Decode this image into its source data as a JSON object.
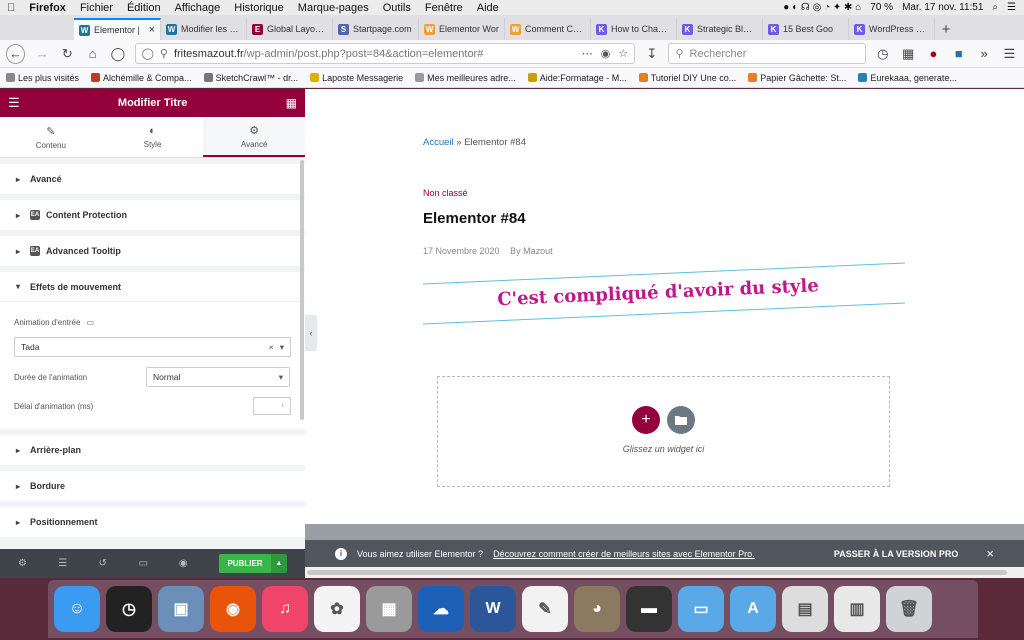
{
  "menubar": {
    "app": "Firefox",
    "items": [
      "Fichier",
      "Édition",
      "Affichage",
      "Historique",
      "Marque-pages",
      "Outils",
      "Fenêtre",
      "Aide"
    ],
    "battery": "70 %",
    "datetime": "Mar. 17 nov.  11:51"
  },
  "tabs": [
    {
      "label": "Elementor |",
      "color": "#21759b",
      "glyph": "W",
      "active": true
    },
    {
      "label": "Modifier les the",
      "color": "#21759b",
      "glyph": "W"
    },
    {
      "label": "Global Layout S",
      "color": "#93003c",
      "glyph": "E"
    },
    {
      "label": "Startpage.com",
      "color": "#5363b3",
      "glyph": "S"
    },
    {
      "label": "Elementor Wor",
      "color": "#f0a030",
      "glyph": "W"
    },
    {
      "label": "Comment Chan",
      "color": "#f0a030",
      "glyph": "W"
    },
    {
      "label": "How to Change",
      "color": "#6c5ce7",
      "glyph": "K"
    },
    {
      "label": "Strategic Blogg",
      "color": "#6c5ce7",
      "glyph": "K"
    },
    {
      "label": "15 Best Goo",
      "color": "#6c5ce7",
      "glyph": "K"
    },
    {
      "label": "WordPress Fre",
      "color": "#6c5ce7",
      "glyph": "K"
    }
  ],
  "nav": {
    "url_host": "fritesmazout.fr",
    "url_path": "/wp-admin/post.php?post=84&action=elementor#",
    "search_placeholder": "Rechercher"
  },
  "bookmarks": [
    {
      "label": "Les plus visités",
      "color": "#888"
    },
    {
      "label": "Alchémille & Compa...",
      "color": "#c0392b"
    },
    {
      "label": "SketchCrawl™ - dr...",
      "color": "#777"
    },
    {
      "label": "Laposte Messagerie",
      "color": "#e0b000"
    },
    {
      "label": "Mes meilleures adre...",
      "color": "#999"
    },
    {
      "label": "Aide:Formatage - M...",
      "color": "#c8a000"
    },
    {
      "label": "Tutoriel DIY Une co...",
      "color": "#e67e22"
    },
    {
      "label": "Papier Gâchette: St...",
      "color": "#e67e22"
    },
    {
      "label": "Eurekaaa, generate...",
      "color": "#2980b9"
    }
  ],
  "panel": {
    "title": "Modifier Titre",
    "tabs": [
      {
        "label": "Contenu",
        "icon": "✎"
      },
      {
        "label": "Style",
        "icon": "◐"
      },
      {
        "label": "Avancé",
        "icon": "⚙",
        "active": true
      }
    ],
    "sections_top": [
      {
        "label": "Avancé",
        "badge": false
      },
      {
        "label": "Content Protection",
        "badge": true
      },
      {
        "label": "Advanced Tooltip",
        "badge": true
      }
    ],
    "motion": {
      "label": "Effets de mouvement",
      "entrance_label": "Animation d'entrée",
      "entrance_value": "Tada",
      "duration_label": "Durée de l'animation",
      "duration_value": "Normal",
      "delay_label": "Délai d'animation (ms)",
      "delay_value": ""
    },
    "sections_bottom": [
      {
        "label": "Arrière-plan"
      },
      {
        "label": "Bordure"
      },
      {
        "label": "Positionnement"
      }
    ],
    "publish": "PUBLIER"
  },
  "preview": {
    "crumb_home": "Accueil",
    "crumb_sep": " » ",
    "crumb_current": "Elementor #84",
    "category": "Non classé",
    "title": "Elementor #84",
    "date": "17 Novembre 2020",
    "author": "By Mazout",
    "styled_heading": "C'est compliqué d'avoir du style",
    "drop_text": "Glissez un widget ici",
    "promo_text": "Vous aimez utiliser Elementor ?",
    "promo_link": "Découvrez comment créer de meilleurs sites avec Elementor Pro.",
    "promo_cta": "PASSER À LA VERSION PRO"
  },
  "colors": {
    "elementor": "#93003c",
    "link": "#1e73be",
    "heading_accent": "#c0188c",
    "publish": "#39b54a"
  },
  "dock": [
    {
      "name": "finder-icon",
      "color": "#3a9bf0",
      "glyph": "☺"
    },
    {
      "name": "launchpad-icon",
      "color": "#222",
      "glyph": "◷"
    },
    {
      "name": "preview-icon",
      "color": "#6b8fb8",
      "glyph": "▣"
    },
    {
      "name": "firefox-icon",
      "color": "#e8550a",
      "glyph": "◉"
    },
    {
      "name": "music-icon",
      "color": "#f0446a",
      "glyph": "♫"
    },
    {
      "name": "photos-icon",
      "color": "#f4f4f4",
      "glyph": "✿"
    },
    {
      "name": "calculator-icon",
      "color": "#9a9a9a",
      "glyph": "▦"
    },
    {
      "name": "openoffice-icon",
      "color": "#1d5fb4",
      "glyph": "☁"
    },
    {
      "name": "word-icon",
      "color": "#2b579a",
      "glyph": "W"
    },
    {
      "name": "textedit-icon",
      "color": "#f2f2f2",
      "glyph": "✎"
    },
    {
      "name": "gimp-icon",
      "color": "#8a7a60",
      "glyph": "◕"
    },
    {
      "name": "scanner-icon",
      "color": "#333",
      "glyph": "▬"
    },
    {
      "name": "folder-icon",
      "color": "#5aa9e6",
      "glyph": "▭"
    },
    {
      "name": "applications-folder-icon",
      "color": "#5aa9e6",
      "glyph": "A"
    },
    {
      "name": "document-icon",
      "color": "#ddd",
      "glyph": "▤"
    },
    {
      "name": "document-preview-icon",
      "color": "#e8e8e8",
      "glyph": "▥"
    },
    {
      "name": "trash-icon",
      "color": "#cfd3d6",
      "glyph": "🗑"
    }
  ]
}
